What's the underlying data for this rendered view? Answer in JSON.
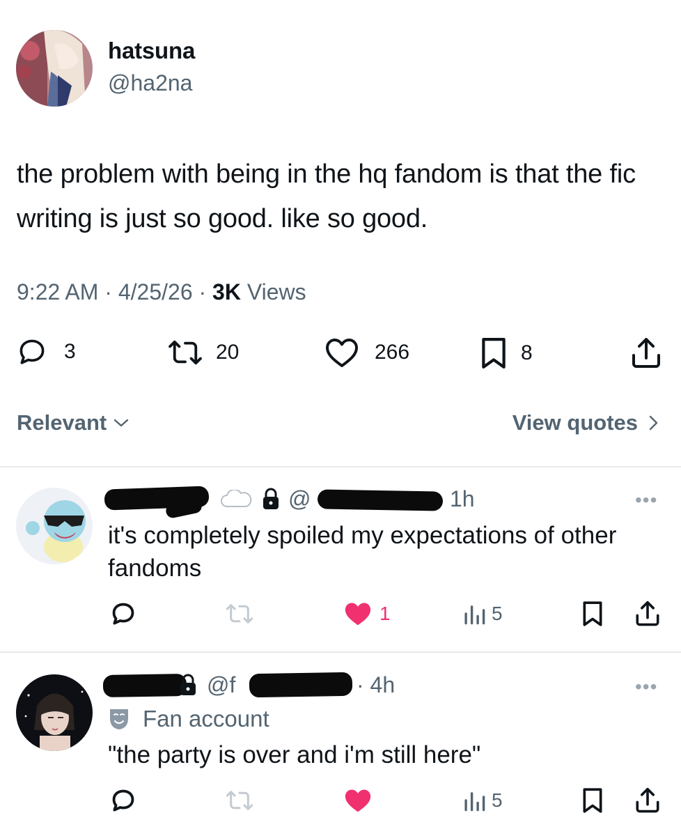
{
  "post": {
    "display_name": "hatsuna",
    "handle": "@ha2na",
    "text": "the problem with being in the hq fandom is that the fic writing is just so good. like so good.",
    "time": "9:22 AM",
    "date": "4/25/26",
    "views_count": "3K",
    "views_label": "Views",
    "actions": {
      "replies": "3",
      "reposts": "20",
      "likes": "266",
      "bookmarks": "8"
    }
  },
  "filter": {
    "label": "Relevant",
    "view_quotes": "View quotes"
  },
  "replies": [
    {
      "handle_prefix": "@",
      "time": "1h",
      "text": "it's completely spoiled my expectations of other fandoms",
      "likes": "1",
      "views": "5",
      "liked": true
    },
    {
      "handle_prefix": "@f",
      "time": "· 4h",
      "badge": "Fan account",
      "text": "\"the party is over and i'm still here\"",
      "likes": "",
      "views": "5",
      "liked": true
    }
  ],
  "colors": {
    "like": "#f91880",
    "secondary": "#536471",
    "text": "#0f1419"
  }
}
